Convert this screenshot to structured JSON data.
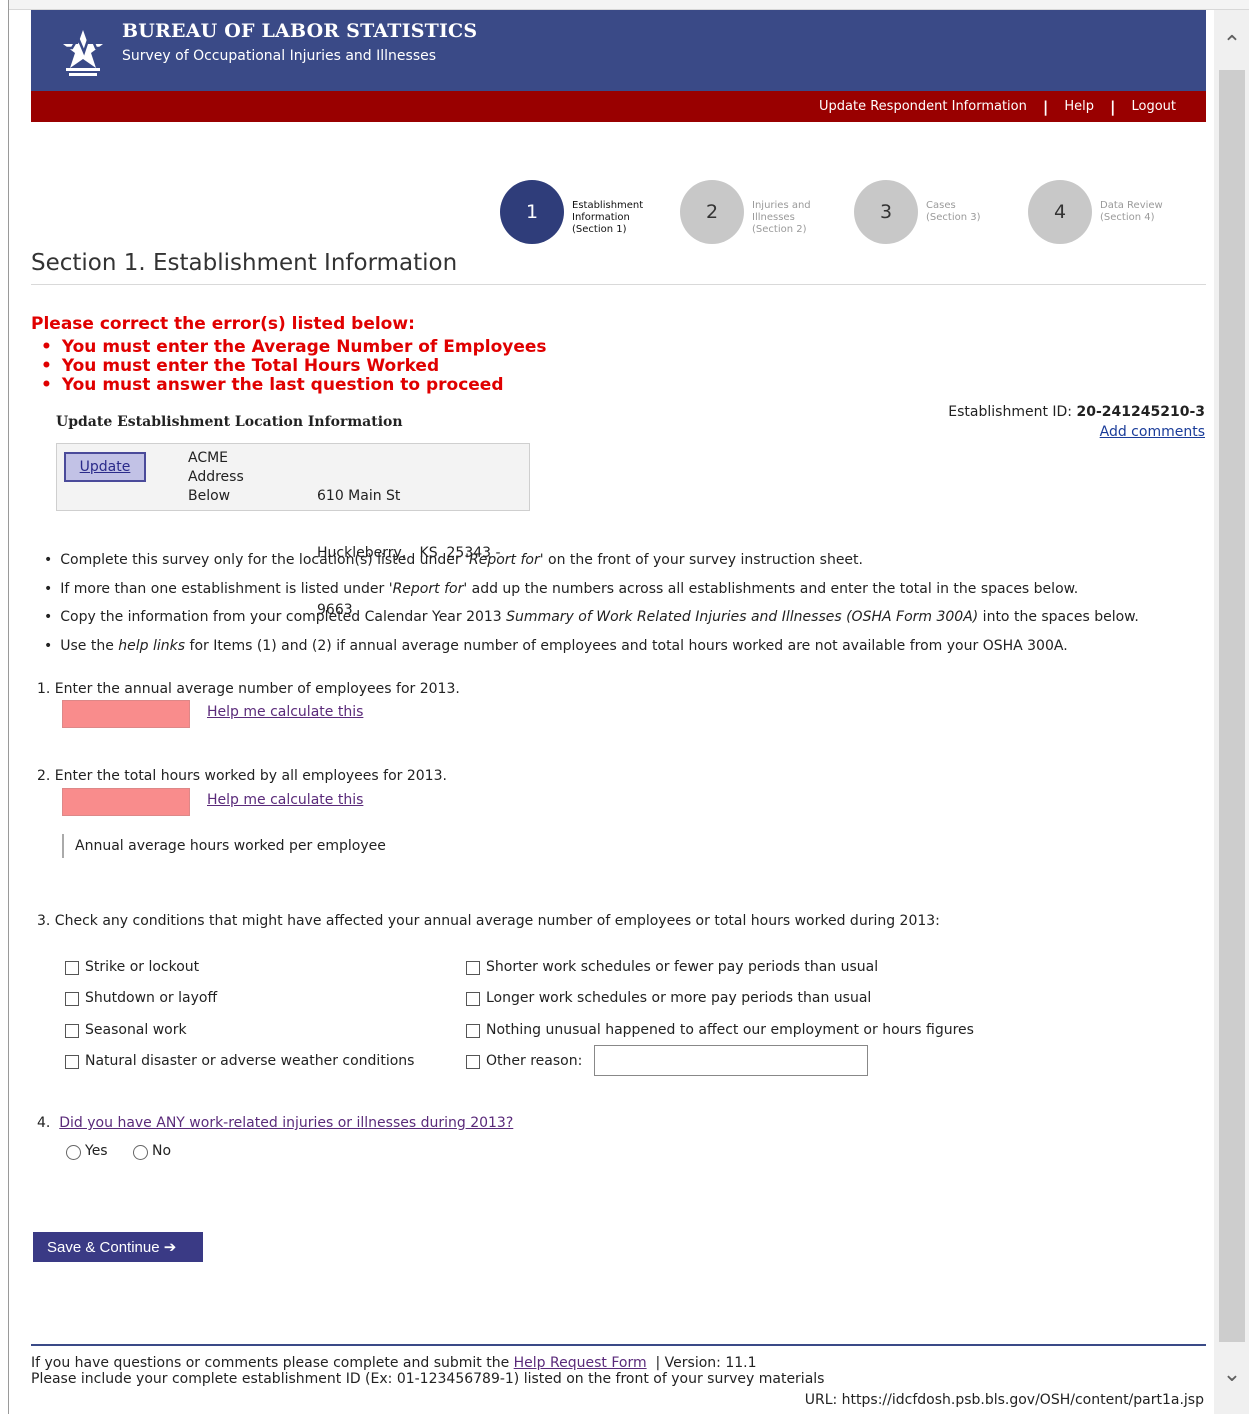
{
  "header": {
    "title": "BUREAU OF LABOR STATISTICS",
    "subtitle": "Survey of Occupational Injuries and Illnesses",
    "nav": [
      "Update Respondent Information",
      "Help",
      "Logout"
    ]
  },
  "steps": [
    {
      "num": "1",
      "line1": "Establishment",
      "line2": "Information",
      "line3": "(Section 1)"
    },
    {
      "num": "2",
      "line1": "Injuries and",
      "line2": "Illnesses",
      "line3": "(Section 2)"
    },
    {
      "num": "3",
      "line1": "Cases",
      "line2": "(Section 3)",
      "line3": ""
    },
    {
      "num": "4",
      "line1": "Data Review",
      "line2": "(Section 4)",
      "line3": ""
    }
  ],
  "page_title": "Section 1. Establishment Information",
  "errors": {
    "heading": "Please correct the error(s) listed below:",
    "items": [
      "You must enter the Average Number of Employees",
      "You must enter the Total Hours Worked",
      "You must answer the last question to proceed"
    ]
  },
  "establishment": {
    "id_label": "Establishment ID:",
    "id_value": "20-241245210-3",
    "add_comments": "Add comments",
    "update_heading": "Update Establishment Location Information",
    "update_button": "Update",
    "name_lines": [
      "ACME",
      "Address",
      "Below"
    ],
    "address_lines": [
      "610 Main St",
      "Huckleberry,   KS  25343 -",
      "9663"
    ]
  },
  "instructions": [
    {
      "pre": "Complete this survey only for the location(s) listed under ",
      "em": "'Report for'",
      "post": " on the front of your survey instruction sheet."
    },
    {
      "pre": "If more than one establishment is listed under ",
      "em": "'Report for'",
      "post": " add up the numbers across all establishments and enter the total in the spaces below."
    },
    {
      "pre": "Copy the information from your completed Calendar Year 2013 ",
      "em": "Summary of Work Related Injuries and Illnesses (OSHA Form 300A)",
      "post": " into the spaces below."
    },
    {
      "pre": "Use the ",
      "em": "help links",
      "post": " for Items (1) and (2) if annual average number of employees and total hours worked are not available from your OSHA 300A."
    }
  ],
  "q1": {
    "label": "1.  Enter the annual average number of employees for 2013.",
    "value": "",
    "help": "Help me calculate this"
  },
  "q2": {
    "label": "2.  Enter the total hours worked by all employees for 2013.",
    "value": "",
    "help": "Help me calculate this",
    "avg_hours": "Annual average hours worked per employee"
  },
  "q3": {
    "label": "3.  Check any conditions that might have affected your annual average number of employees or total hours worked during 2013:",
    "left_options": [
      "Strike or lockout",
      "Shutdown or layoff",
      "Seasonal work",
      "Natural disaster or adverse weather conditions"
    ],
    "right_options": [
      "Shorter work schedules or fewer pay periods than usual",
      "Longer work schedules or more pay periods than usual",
      "Nothing unusual happened to affect our employment or hours figures",
      "Other reason:"
    ],
    "other_value": ""
  },
  "q4": {
    "number": "4.",
    "label": "Did you have ANY work-related injuries or illnesses during 2013?",
    "yes": "Yes",
    "no": "No"
  },
  "save_button": "Save & Continue ➔",
  "footer": {
    "line1_pre": "If you have questions or comments please complete and submit the ",
    "line1_link": "Help Request Form",
    "line1_post": "  | Version: 11.1",
    "line2": "Please include your complete establishment ID (Ex: 01-123456789-1) listed on the front of your survey materials",
    "url": "URL: https://idcfdosh.psb.bls.gov/OSH/content/part1a.jsp"
  },
  "colors": {
    "banner": "#3a4a87",
    "redbar": "#990000",
    "error": "#e00000",
    "invalid_input": "#f98c8c"
  }
}
